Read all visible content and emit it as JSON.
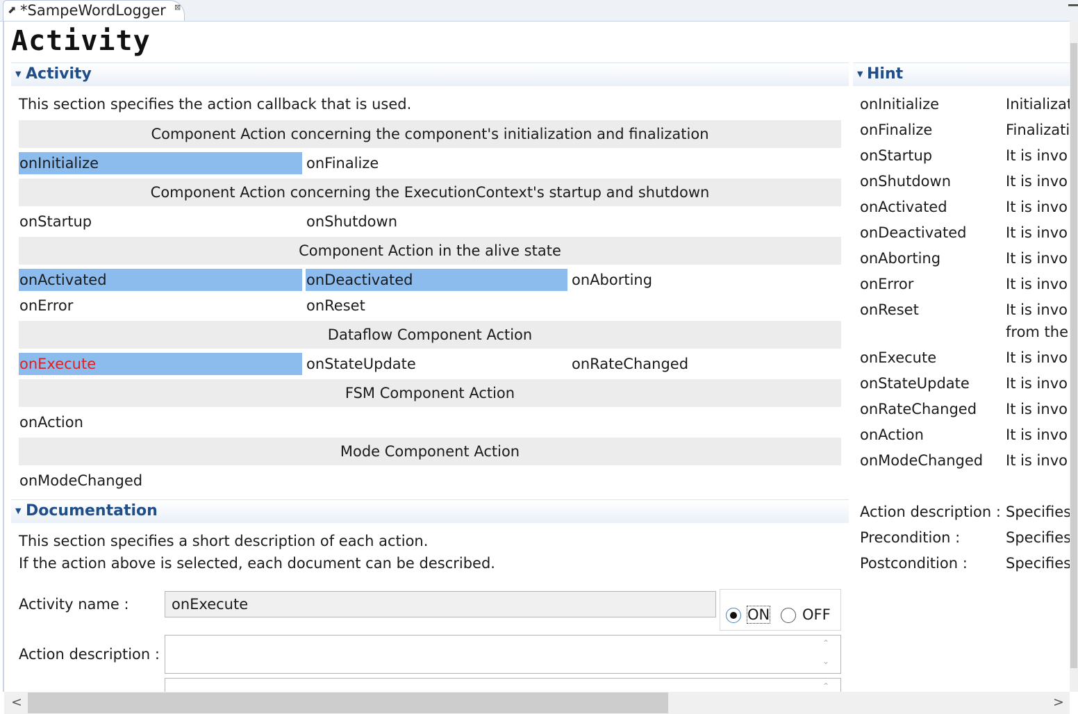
{
  "tab": {
    "title": "*SampeWordLogger",
    "close_glyph": "⊠",
    "edit_glyph": "⬈"
  },
  "form": {
    "title": "Activity"
  },
  "activity_section": {
    "title": "Activity",
    "description": "This section specifies the action callback that is used.",
    "groups": {
      "init": "Component Action concerning the component's initialization and finalization",
      "ec": "Component Action concerning the ExecutionContext's startup and shutdown",
      "alive": "Component Action in the alive state",
      "dataflow": "Dataflow Component Action",
      "fsm": "FSM Component Action",
      "mode": "Mode Component Action"
    },
    "actions": {
      "onInitialize": "onInitialize",
      "onFinalize": "onFinalize",
      "onStartup": "onStartup",
      "onShutdown": "onShutdown",
      "onActivated": "onActivated",
      "onDeactivated": "onDeactivated",
      "onAborting": "onAborting",
      "onError": "onError",
      "onReset": "onReset",
      "onExecute": "onExecute",
      "onStateUpdate": "onStateUpdate",
      "onRateChanged": "onRateChanged",
      "onAction": "onAction",
      "onModeChanged": "onModeChanged"
    },
    "selected_color": "#8cbcee",
    "current_color": "#e02020"
  },
  "documentation_section": {
    "title": "Documentation",
    "description_line1": "This section specifies a short description of each action.",
    "description_line2": "If the action above is selected, each document can be described.",
    "activity_name_label": "Activity name :",
    "activity_name_value": "onExecute",
    "on_label": "ON",
    "off_label": "OFF",
    "action_description_label": "Action description :"
  },
  "hint_section": {
    "title": "Hint",
    "rows": [
      {
        "name": "onInitialize",
        "text": "Initializat"
      },
      {
        "name": "onFinalize",
        "text": "Finalizati"
      },
      {
        "name": "onStartup",
        "text": "It is invo"
      },
      {
        "name": "onShutdown",
        "text": "It is invo"
      },
      {
        "name": "onActivated",
        "text": "It is invo"
      },
      {
        "name": "onDeactivated",
        "text": "It is invo"
      },
      {
        "name": "onAborting",
        "text": "It is invo"
      },
      {
        "name": "onError",
        "text": "It is invo"
      },
      {
        "name": "onReset",
        "text": "It is invo",
        "text2": "from the"
      },
      {
        "name": "onExecute",
        "text": "It is invo"
      },
      {
        "name": "onStateUpdate",
        "text": "It is invo"
      },
      {
        "name": "onRateChanged",
        "text": "It is invo"
      },
      {
        "name": "onAction",
        "text": "It is invo"
      },
      {
        "name": "onModeChanged",
        "text": "It is invo"
      }
    ],
    "doc_rows": [
      {
        "name": "Action description :",
        "text": "Specifies"
      },
      {
        "name": "Precondition :",
        "text": "Specifies"
      },
      {
        "name": "Postcondition :",
        "text": "Specifies"
      }
    ]
  },
  "scroll": {
    "left_arrow": "<",
    "right_arrow": ">",
    "up_arrow": "⌃",
    "down_arrow": "⌄"
  }
}
